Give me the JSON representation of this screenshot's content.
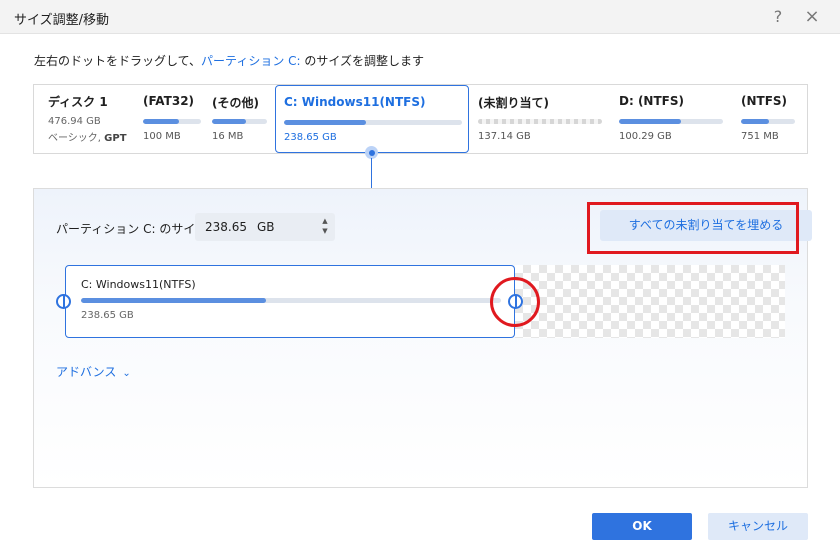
{
  "window": {
    "title": "サイズ調整/移動",
    "help_icon": "?",
    "close_icon": "×"
  },
  "instruction": {
    "prefix": "左右のドットをドラッグして、",
    "link": "パーティション C:",
    "suffix": " のサイズを調整します"
  },
  "disk": {
    "name": "ディスク 1",
    "size": "476.94 GB",
    "type_prefix": "ベーシック, ",
    "type_bold": "GPT"
  },
  "partitions": [
    {
      "name": "(FAT32)",
      "size": "100 MB",
      "usage": 0.62
    },
    {
      "name": "(その他)",
      "size": "16 MB",
      "usage": 0.62
    },
    {
      "name": "C: Windows11(NTFS)",
      "size": "238.65 GB",
      "usage": 0.46,
      "selected": true
    },
    {
      "name": "(未割り当て)",
      "size": "137.14 GB",
      "unallocated": true
    },
    {
      "name": "D: (NTFS)",
      "size": "100.29 GB",
      "usage": 0.6
    },
    {
      "name": "(NTFS)",
      "size": "751 MB",
      "usage": 0.52
    }
  ],
  "resize": {
    "size_label": "パーティション C: のサイズ",
    "size_value": "238.65",
    "size_unit": "GB",
    "fill_button": "すべての未割り当てを埋める",
    "card_title": "C: Windows11(NTFS)",
    "card_size": "238.65 GB",
    "card_usage": 0.44,
    "advanced_label": "アドバンス"
  },
  "footer": {
    "ok_label": "OK",
    "cancel_label": "キャンセル"
  },
  "colors": {
    "accent": "#2f73df",
    "highlight": "#e0191f"
  }
}
